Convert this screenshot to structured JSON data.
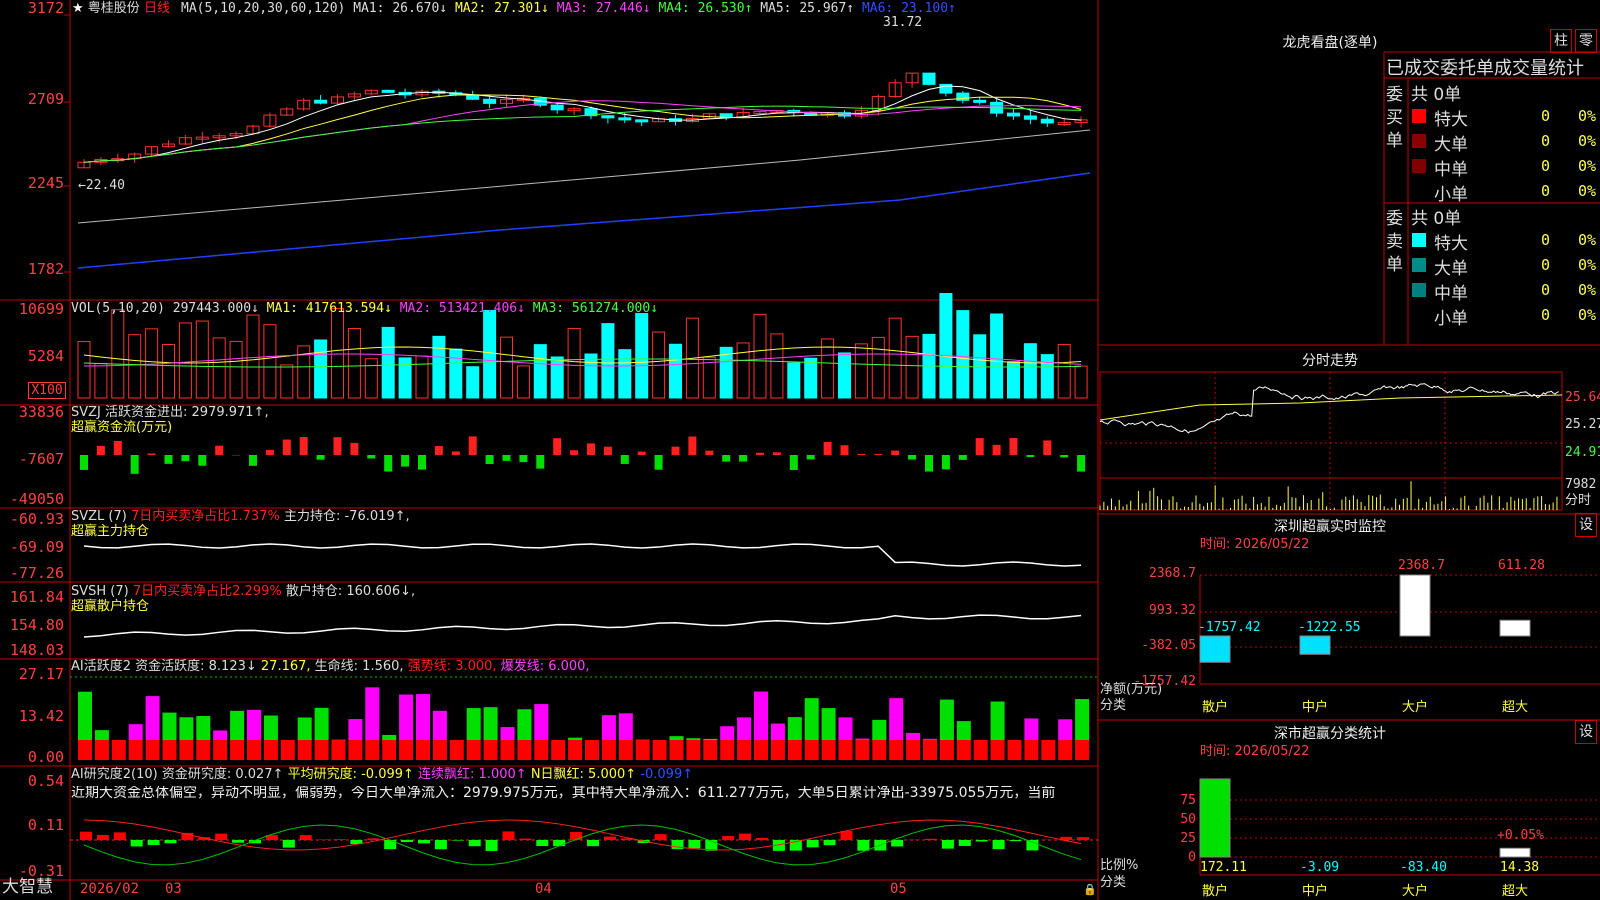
{
  "stock": {
    "name": "粤桂股份",
    "period": "日线"
  },
  "main_chart": {
    "ma_header": {
      "label": "MA(5,10,20,30,60,120)",
      "ma1": "MA1: 26.670↓",
      "ma2": "MA2: 27.301↓",
      "ma3": "MA3: 27.446↓",
      "ma4": "MA4: 26.530↑",
      "ma5": "MA5: 25.967↑",
      "ma6": "MA6: 23.100↑"
    },
    "y_ticks": [
      "3172",
      "2709",
      "2245",
      "1782"
    ],
    "annot_high": "31.72",
    "annot_low": "←22.40"
  },
  "volume": {
    "header": {
      "label": "VOL(5,10,20)",
      "v": "297443.000↓",
      "ma1": "MA1: 417613.594↓",
      "ma2": "MA2: 513421.406↓",
      "ma3": "MA3: 561274.000↓"
    },
    "y_ticks": [
      "10699",
      "5284"
    ],
    "unit": "X100"
  },
  "svzj": {
    "header": "SVZJ  活跃资金进出: 2979.971↑,",
    "sub": "超赢资金流(万元)",
    "y_ticks": [
      "33836",
      "-7607",
      "-49050"
    ]
  },
  "svzl": {
    "h1": "SVZL (7)",
    "h2": "7日内买卖净占比1.737%",
    "h3": "主力持仓: -76.019↑,",
    "sub": "超赢主力持仓",
    "y_ticks": [
      "-60.93",
      "-69.09",
      "-77.26"
    ]
  },
  "svsh": {
    "h1": "SVSH (7)",
    "h2": "7日内买卖净占比2.299%",
    "h3": "散户持仓: 160.606↓,",
    "sub": "超赢散户持仓",
    "y_ticks": [
      "161.84",
      "154.80",
      "148.03"
    ]
  },
  "ai_active": {
    "h1": "AI活跃度2",
    "h2": "资金活跃度: 8.123↓",
    "h3": "27.167,",
    "h4": "生命线: 1.560,",
    "h5": "强势线: 3.000,",
    "h6": "爆发线: 6.000,",
    "y_ticks": [
      "27.17",
      "13.42",
      "0.00"
    ]
  },
  "ai_research": {
    "h1": "AI研究度2(10)",
    "h2": "资金研究度: 0.027↑",
    "h3": "平均研究度: -0.099↑",
    "h4": "连续飘红: 1.000↑",
    "h5": "N日飘红: 5.000↑",
    "h6": "-0.099↑",
    "summary": "近期大资金总体偏空，异动不明显，偏弱势，今日大单净流入：2979.975万元，其中特大单净流入：611.277万元，大单5日累计净出-33975.055万元，当前",
    "y_ticks": [
      "0.54",
      "0.11",
      "-0.31"
    ]
  },
  "x_axis": {
    "labels": [
      "2026/02",
      "03",
      "04",
      "05"
    ],
    "brand": "大智慧"
  },
  "dragon": {
    "title": "龙虎看盘(逐单)",
    "btn_bar": "柱",
    "btn_lattice": "零",
    "header": "已成交委托单成交量统计",
    "buy_side": "委买单",
    "sell_side": "委卖单",
    "buy_total": "共 0单",
    "sell_total": "共 0单",
    "rows": [
      {
        "label": "特大",
        "count": "0",
        "pct": "0%"
      },
      {
        "label": "大单",
        "count": "0",
        "pct": "0%"
      },
      {
        "label": "中单",
        "count": "0",
        "pct": "0%"
      },
      {
        "label": "小单",
        "count": "0",
        "pct": "0%"
      }
    ],
    "colors": {
      "buy": [
        "#ff0000",
        "#8b0000",
        "#800000"
      ],
      "sell": [
        "#00ffff",
        "#008b8b",
        "#008080"
      ]
    }
  },
  "intraday": {
    "title": "分时走势",
    "y_ticks": [
      "25.64",
      "25.27",
      "24.91"
    ],
    "vol_tick": "7982",
    "vol_label": "分时"
  },
  "sz_monitor": {
    "title": "深圳超赢实时监控",
    "set_btn": "设",
    "time": "时间: 2026/05/22",
    "y_ticks": [
      "2368.7",
      "993.32",
      "-382.05",
      "-1757.42"
    ],
    "ylabel": "净额(万元)",
    "xlabel": "分类",
    "categories": [
      "散户",
      "中户",
      "大户",
      "超大"
    ],
    "values": [
      -1757.42,
      -1222.55,
      2368.7,
      611.28
    ],
    "value_labels": [
      "-1757.42",
      "-1222.55",
      "2368.7",
      "611.28"
    ]
  },
  "sz_class": {
    "title": "深市超赢分类统计",
    "set_btn": "设",
    "time": "时间: 2026/05/22",
    "y_ticks": [
      "75",
      "50",
      "25",
      "0"
    ],
    "ylabel": "比例%",
    "xlabel": "分类",
    "categories": [
      "散户",
      "中户",
      "大户",
      "超大"
    ],
    "values": [
      172.11,
      -3.09,
      -83.4,
      14.38
    ],
    "value_labels": [
      "172.11",
      "-3.09",
      "-83.40",
      "14.38"
    ],
    "pct_label": "+0.05%"
  }
}
